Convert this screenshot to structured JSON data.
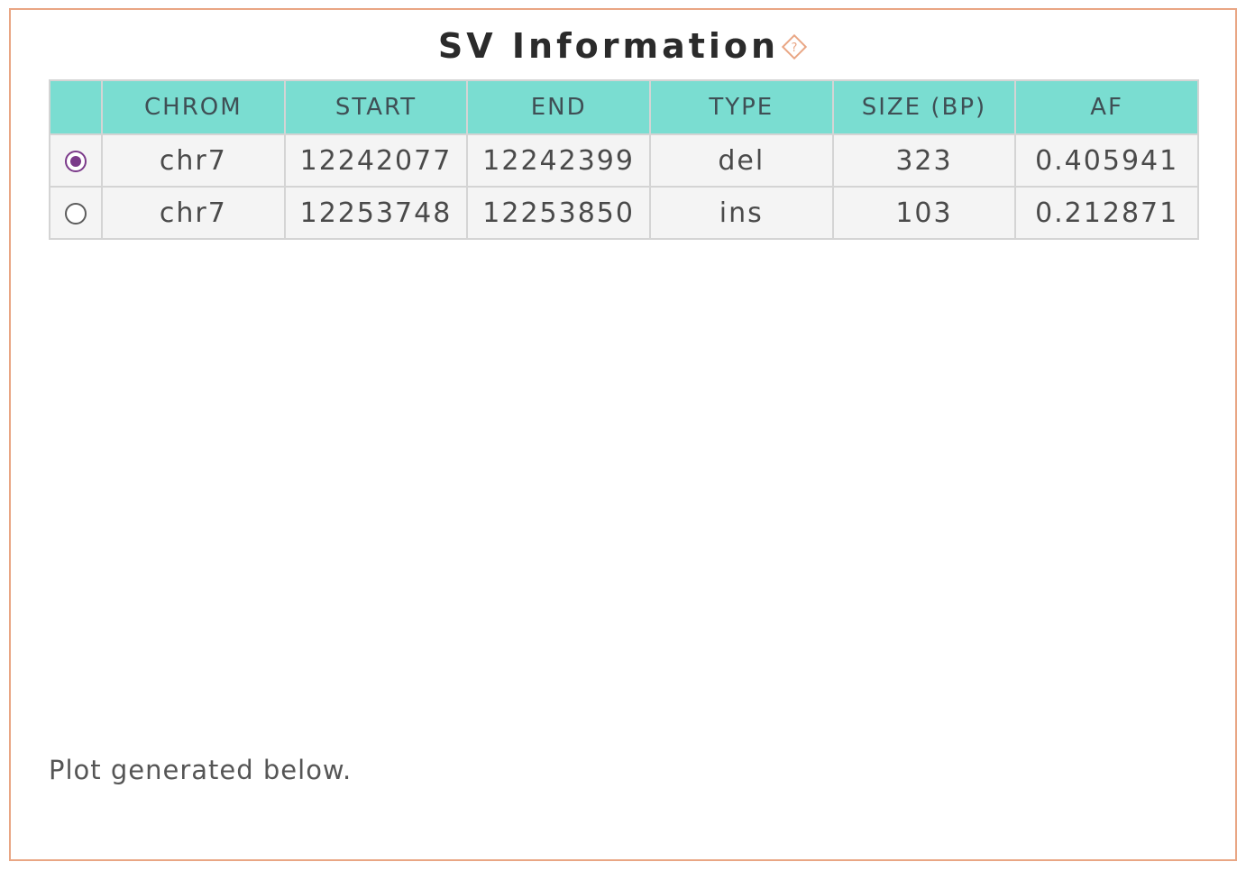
{
  "panel": {
    "title": "SV Information",
    "help_icon": "question-diamond-icon",
    "border_color": "#e9a684",
    "accent_color": "#7addd1",
    "selected_color": "#7b3a8a"
  },
  "table": {
    "headers": [
      "CHROM",
      "START",
      "END",
      "TYPE",
      "SIZE (BP)",
      "AF"
    ],
    "rows": [
      {
        "selected": true,
        "chrom": "chr7",
        "start": "12242077",
        "end": "12242399",
        "type": "del",
        "size": "323",
        "af": "0.405941"
      },
      {
        "selected": false,
        "chrom": "chr7",
        "start": "12253748",
        "end": "12253850",
        "type": "ins",
        "size": "103",
        "af": "0.212871"
      }
    ]
  },
  "footer": {
    "note": "Plot generated below."
  }
}
